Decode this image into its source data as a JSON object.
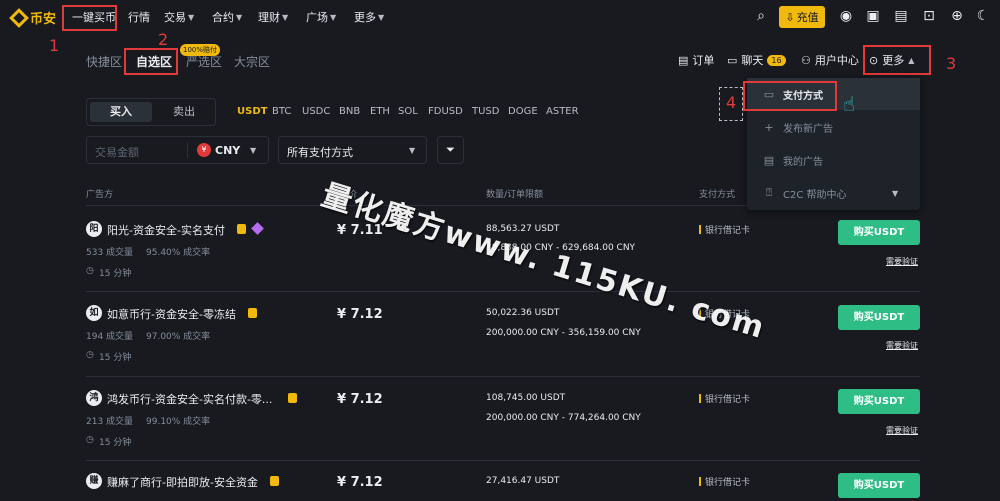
{
  "nav": {
    "logo_text": "币安",
    "quick_buy": "一键买币",
    "markets": "行情",
    "trade": "交易",
    "futures": "合约",
    "finance": "理财",
    "square": "广场",
    "more": "更多",
    "deposit": "充值"
  },
  "subtabs": {
    "express": "快捷区",
    "p2p": "自选区",
    "badge": "100%赔付",
    "select": "严选区",
    "block": "大宗区"
  },
  "links": {
    "orders": "订单",
    "chat": "聊天",
    "chat_count": "16",
    "user_center": "用户中心",
    "more": "更多"
  },
  "toggle": {
    "buy": "买入",
    "sell": "卖出"
  },
  "coins": [
    "USDT",
    "BTC",
    "USDC",
    "BNB",
    "ETH",
    "SOL",
    "FDUSD",
    "TUSD",
    "DOGE",
    "ASTER"
  ],
  "filters": {
    "amount_placeholder": "交易金额",
    "currency": "CNY",
    "currency_symbol": "¥",
    "payment": "所有支付方式"
  },
  "table": {
    "headers": {
      "advertiser": "广告方",
      "price": "单价",
      "limit": "数量/订单限额",
      "payment": "支付方式"
    },
    "rows": [
      {
        "avatar": "阳",
        "name": "阳光-资金安全-实名支付",
        "trades": "533 成交量",
        "rate": "95.40% 成交率",
        "time": "15 分钟",
        "price": "¥ 7.11",
        "available": "88,563.27 USDT",
        "limit": "88,888.00 CNY - 629,684.00 CNY",
        "payment": "银行借记卡",
        "buy": "购买USDT",
        "verify": "需要验证"
      },
      {
        "avatar": "如",
        "name": "如意币行-资金安全-零冻结",
        "trades": "194 成交量",
        "rate": "97.00% 成交率",
        "time": "15 分钟",
        "price": "¥ 7.12",
        "available": "50,022.36 USDT",
        "limit": "200,000.00 CNY - 356,159.00 CNY",
        "payment": "银行借记卡",
        "buy": "购买USDT",
        "verify": "需要验证"
      },
      {
        "avatar": "鸿",
        "name": "鸿发币行-资金安全-实名付款-零...",
        "trades": "213 成交量",
        "rate": "99.10% 成交率",
        "time": "15 分钟",
        "price": "¥ 7.12",
        "available": "108,745.00 USDT",
        "limit": "200,000.00 CNY - 774,264.00 CNY",
        "payment": "银行借记卡",
        "buy": "购买USDT",
        "verify": "需要验证"
      },
      {
        "avatar": "赚",
        "name": "赚麻了商行-即拍即放-安全资金",
        "trades": "",
        "rate": "",
        "time": "",
        "price": "¥ 7.12",
        "available": "27,416.47 USDT",
        "limit": "",
        "payment": "银行借记卡",
        "buy": "购买USDT",
        "verify": ""
      }
    ]
  },
  "dropdown": {
    "items": [
      "支付方式",
      "发布新广告",
      "我的广告",
      "C2C 帮助中心"
    ]
  },
  "annotations": [
    "1",
    "2",
    "3",
    "4"
  ],
  "watermark": "量化魔方www. 115KU. com",
  "colors": {
    "accent": "#f0b90b",
    "buy": "#2ebd85",
    "annotation": "#e03a3a",
    "background": "#181a20"
  }
}
